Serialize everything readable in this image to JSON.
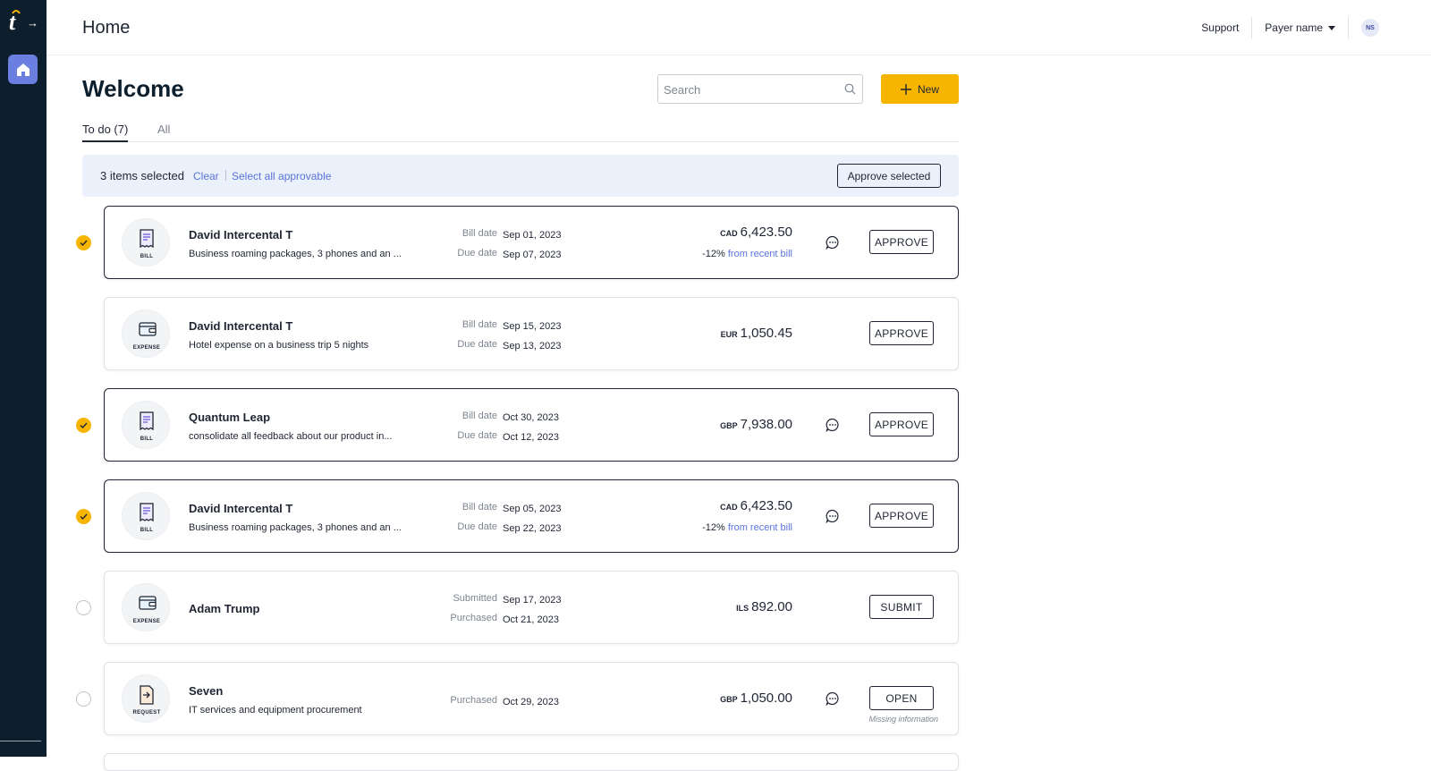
{
  "sidebar": {
    "logo_letter": "t",
    "logo_arrow": "→"
  },
  "header": {
    "title": "Home",
    "support": "Support",
    "payer": "Payer name",
    "avatar": "NS"
  },
  "main": {
    "welcome": "Welcome",
    "search_placeholder": "Search",
    "new_label": "New",
    "tabs": [
      {
        "label": "To do (7)"
      },
      {
        "label": "All"
      }
    ],
    "selection": {
      "count_label": "3 items selected",
      "clear": "Clear",
      "select_all": "Select all approvable",
      "approve_selected": "Approve selected"
    },
    "items": [
      {
        "type": "BILL",
        "name": "David Intercental T",
        "desc": "Business roaming packages, 3 phones and an ...",
        "label1": "Bill date",
        "date1": "Sep 01, 2023",
        "label2": "Due date",
        "date2": "Sep 07, 2023",
        "currency": "CAD",
        "amount": "6,423.50",
        "change_pct": "-12%",
        "change_text": "from recent bill",
        "action": "APPROVE",
        "checked": true
      },
      {
        "type": "EXPENSE",
        "name": "David Intercental T",
        "desc": "Hotel expense on a business trip 5 nights",
        "label1": "Bill date",
        "date1": "Sep 15, 2023",
        "label2": "Due date",
        "date2": "Sep 13, 2023",
        "currency": "EUR",
        "amount": "1,050.45",
        "action": "APPROVE"
      },
      {
        "type": "BILL",
        "name": "Quantum Leap",
        "desc": "consolidate all feedback about our product in...",
        "label1": "Bill date",
        "date1": "Oct 30, 2023",
        "label2": "Due date",
        "date2": "Oct 12, 2023",
        "currency": "GBP",
        "amount": "7,938.00",
        "action": "APPROVE",
        "checked": true
      },
      {
        "type": "BILL",
        "name": "David Intercental T",
        "desc": "Business roaming packages, 3 phones and an ...",
        "label1": "Bill date",
        "date1": "Sep 05, 2023",
        "label2": "Due date",
        "date2": "Sep 22, 2023",
        "currency": "CAD",
        "amount": "6,423.50",
        "change_pct": "-12%",
        "change_text": "from recent bill",
        "action": "APPROVE",
        "checked": true
      },
      {
        "type": "EXPENSE",
        "name": "Adam Trump",
        "label1": "Submitted",
        "date1": "Sep 17, 2023",
        "label2": "Purchased",
        "date2": "Oct 21, 2023",
        "currency": "ILS",
        "amount": "892.00",
        "action": "SUBMIT",
        "checked": false
      },
      {
        "type": "REQUEST",
        "name": "Seven",
        "desc": "IT services and equipment procurement",
        "label1": "Purchased",
        "date1": "Oct 29, 2023",
        "currency": "GBP",
        "amount": "1,050.00",
        "action": "OPEN",
        "note": "Missing information",
        "checked": false
      }
    ]
  }
}
